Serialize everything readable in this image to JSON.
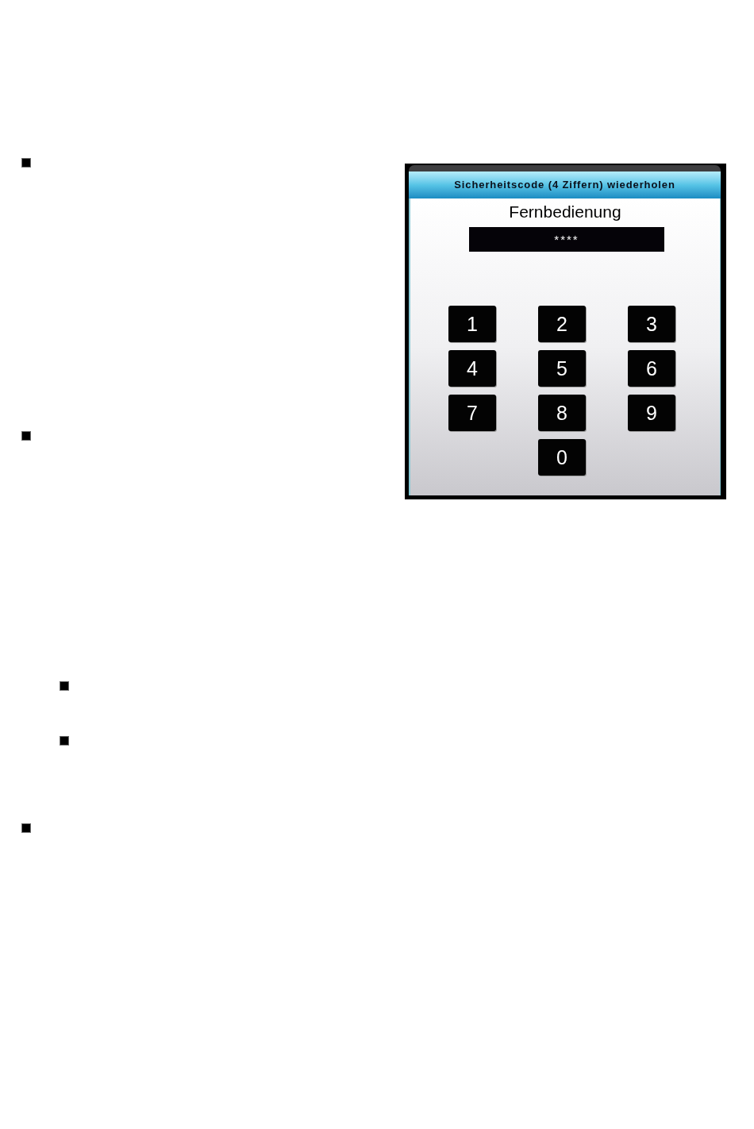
{
  "list": [
    {
      "kind": "square"
    },
    {
      "kind": "square",
      "children": [
        {
          "kind": "square"
        },
        {
          "kind": "square"
        }
      ]
    },
    {
      "kind": "square"
    }
  ],
  "dialog": {
    "title": "Sicherheitscode (4 Ziffern) wiederholen",
    "label": "Fernbedienung",
    "code_field": {
      "value": "****"
    },
    "keys": [
      "1",
      "2",
      "3",
      "4",
      "5",
      "6",
      "7",
      "8",
      "9",
      "0"
    ]
  }
}
